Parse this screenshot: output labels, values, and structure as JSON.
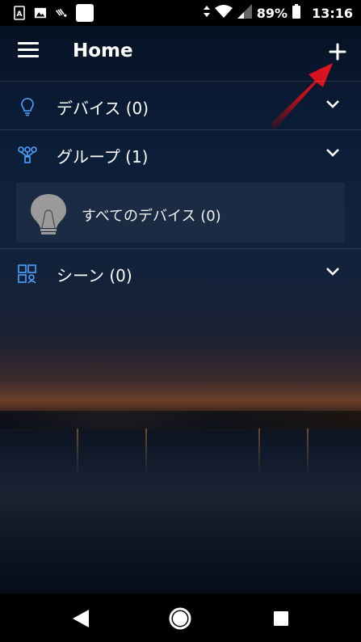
{
  "status_bar": {
    "battery_percent": "89%",
    "time": "13:16",
    "left_icons": [
      "sim-card-icon",
      "image-icon",
      "cast-icon",
      "app-square-icon"
    ]
  },
  "app_bar": {
    "title": "Home",
    "menu_icon": "hamburger-menu-icon",
    "add_icon": "plus-icon"
  },
  "sections": [
    {
      "label": "デバイス (0)",
      "icon": "lightbulb-icon",
      "expanded": false
    },
    {
      "label": "グループ (1)",
      "icon": "group-nodes-icon",
      "expanded": true,
      "items": [
        {
          "label": "すべてのデバイス (0)",
          "icon": "bulb-grey-icon"
        }
      ]
    },
    {
      "label": "シーン (0)",
      "icon": "scene-grid-icon",
      "expanded": false
    }
  ],
  "nav_bar": {
    "back": "back-icon",
    "home": "home-icon",
    "recents": "recents-icon"
  },
  "colors": {
    "accent_icon": "#4da3ff",
    "annotation_arrow": "#d40f1e",
    "bar": "#000000"
  }
}
